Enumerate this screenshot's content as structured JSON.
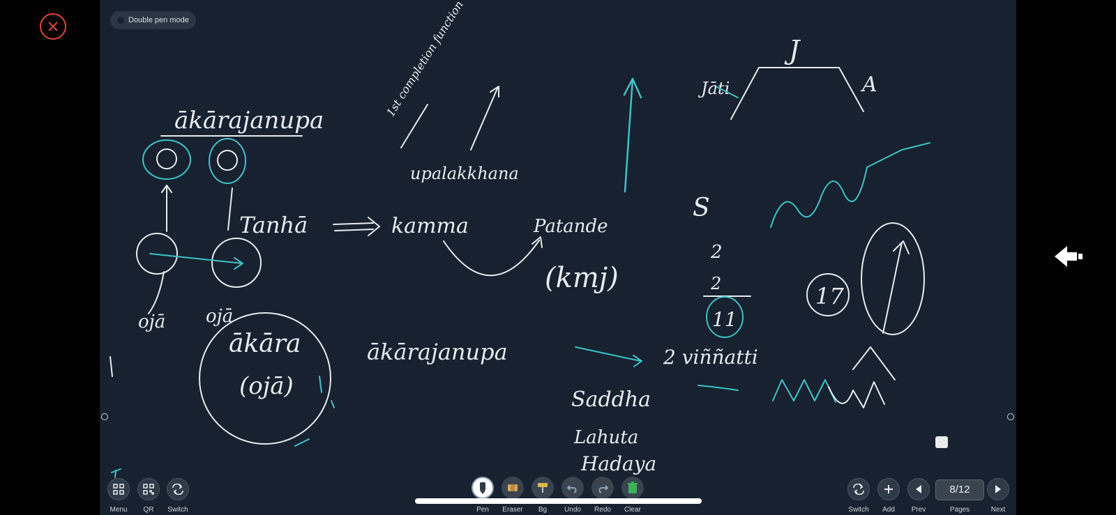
{
  "app": {
    "double_pen_label": "Double pen mode"
  },
  "board_text": {
    "title_note": "ākārajanupa",
    "tanha": "Tanhā",
    "kamma": "kamma",
    "patande": "Patande",
    "kmj": "(kmj)",
    "completion": "1st completion function",
    "upalakkhana": "upalakkhana",
    "oja_left": "ojā",
    "oja_right": "ojā",
    "akara": "ākāra",
    "oja_paren": "(ojā)",
    "akarajanupa_2": "ākārajanupa",
    "letter_j": "J",
    "letter_a": "A",
    "jati": "Jāti",
    "letter_s": "S",
    "numbers_stack": [
      "2",
      "2",
      "11"
    ],
    "circle_17": "17",
    "vinnatti": "2 viññatti",
    "saddha": "Saddha",
    "lahuta": "Lahuta",
    "hadaya": "Hadaya"
  },
  "toolbar": {
    "left": [
      {
        "label": "Menu",
        "icon": "menu-grid-icon"
      },
      {
        "label": "QR",
        "icon": "qr-code-icon"
      },
      {
        "label": "Switch",
        "icon": "switch-arrows-icon"
      }
    ],
    "tools": [
      {
        "label": "Pen",
        "icon": "pen-icon",
        "active": true
      },
      {
        "label": "Eraser",
        "icon": "eraser-icon"
      },
      {
        "label": "Bg",
        "icon": "background-roller-icon"
      },
      {
        "label": "Undo",
        "icon": "undo-icon"
      },
      {
        "label": "Redo",
        "icon": "redo-icon"
      },
      {
        "label": "Clear",
        "icon": "trash-icon"
      }
    ],
    "right": [
      {
        "label": "Switch",
        "icon": "switch-arrows-icon"
      },
      {
        "label": "Add",
        "icon": "plus-icon"
      },
      {
        "label": "Prev",
        "icon": "prev-triangle-icon"
      },
      {
        "label": "Pages"
      },
      {
        "label": "Next",
        "icon": "next-triangle-icon"
      }
    ],
    "page_indicator": "8/12"
  },
  "colors": {
    "board_bg": "#17212f",
    "ink_white": "#e8ecf0",
    "ink_cyan": "#3cc4c8",
    "close_red": "#e0453a",
    "clear_green": "#3cb05a"
  }
}
